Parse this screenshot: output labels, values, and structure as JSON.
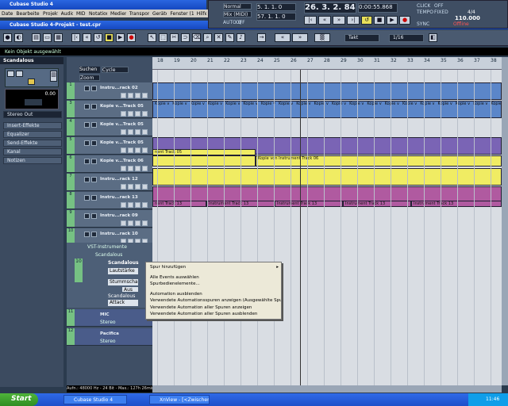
{
  "window": {
    "title": "Cubase Studio 4",
    "project_title": "Cubase Studio 4-Projekt - test.cpr"
  },
  "menu": [
    "Datei",
    "Bearbeiten",
    "Projekt",
    "Audio",
    "MIDI",
    "Notation",
    "Medien",
    "Transport",
    "Geräte",
    "Fenster (1)",
    "Hilfe"
  ],
  "transport": {
    "mode": "Normal",
    "mix": "Mix (MIDI)",
    "auto": "AUTO Q",
    "auto_state": "OFF",
    "left_locator": "5. 1. 1. 0",
    "right_locator": "57. 1. 1. 0",
    "position": "26. 3. 2. 84",
    "time": "0:00:55.868",
    "click_label": "CLICK",
    "click_state": "OFF",
    "tempo_label": "TEMPO",
    "tempo_mode": "FIXED",
    "signature": "4/4",
    "tempo": "110.000",
    "sync_label": "SYNC",
    "sync_state": "Offline"
  },
  "toolbar": {
    "snap_label": "Takt",
    "quantize": "1/16"
  },
  "infobar": "Kein Objekt ausgewählt",
  "inspector": {
    "track_name": "Scandalous",
    "value": "0.00",
    "output": "Stereo Out",
    "sections": [
      "Insert-Effekte",
      "Equalizer",
      "Send-Effekte",
      "Kanal",
      "Notizen"
    ],
    "search_label": "Suchen",
    "cycle": "Cycle",
    "zoom": "Zoom"
  },
  "tracks": [
    {
      "num": "1",
      "name": "Instru...rack 02"
    },
    {
      "num": "3",
      "name": "Kopie v...Track 05"
    },
    {
      "num": "4",
      "name": "Kopie v...Track 05"
    },
    {
      "num": "5",
      "name": "Kopie v...Track 05"
    },
    {
      "num": "6",
      "name": "Kopie v...Track 06"
    },
    {
      "num": "7",
      "name": "Instru...rack 12"
    },
    {
      "num": "8",
      "name": "Instru...rack 13"
    },
    {
      "num": "9",
      "name": "Instru...rack 09"
    },
    {
      "num": "10",
      "name": "Instru...rack 10"
    }
  ],
  "vst_folder": {
    "label": "VST-Instrumente",
    "sub": "Scandalous",
    "track_num": "10",
    "track_name": "Scandalous",
    "param": "Lautstärke",
    "param2": "Stummschalten",
    "param2_val": "Aus",
    "sub2": "Scandalous",
    "param3": "Attack"
  },
  "extra_tracks": [
    {
      "num": "11",
      "name": "MIC",
      "sub": "Stereo"
    },
    {
      "num": "12",
      "name": "Pacifica",
      "sub": "Stereo"
    }
  ],
  "ruler": [
    "18",
    "19",
    "20",
    "21",
    "22",
    "23",
    "24",
    "25",
    "26",
    "27",
    "28",
    "29",
    "30",
    "31",
    "32",
    "33",
    "34",
    "35",
    "36",
    "37",
    "38"
  ],
  "parts": {
    "p1": "nent Track 05",
    "p2": "Kopie von Instrument Track 06",
    "p3": "nent Track 13",
    "p4": "Instrument Track 13",
    "repeat": "Kopie v"
  },
  "context_menu": [
    "Spur hinzufügen",
    "Alle Events auswählen",
    "Spurbedienelemente...",
    "Automation ausblenden",
    "Verwendete Automationsspuren anzeigen (Ausgewählte Spuren)",
    "Verwendete Automation aller Spuren anzeigen",
    "Verwendete Automation aller Spuren ausblenden"
  ],
  "status": "Aufn.: 48000 Hz - 24 Bit - Max.: 127h 26min",
  "taskbar": {
    "start": "Start",
    "tasks": [
      "Cubase Studio 4",
      "XnView - [<Zwischen..."
    ],
    "clock": "11:46"
  },
  "colors": {
    "blue_track": "#5b86c9",
    "purple_track": "#7a64b5",
    "yellow_track": "#f0ec63",
    "magenta_track": "#b05aa0",
    "green_track": "#76c183"
  }
}
